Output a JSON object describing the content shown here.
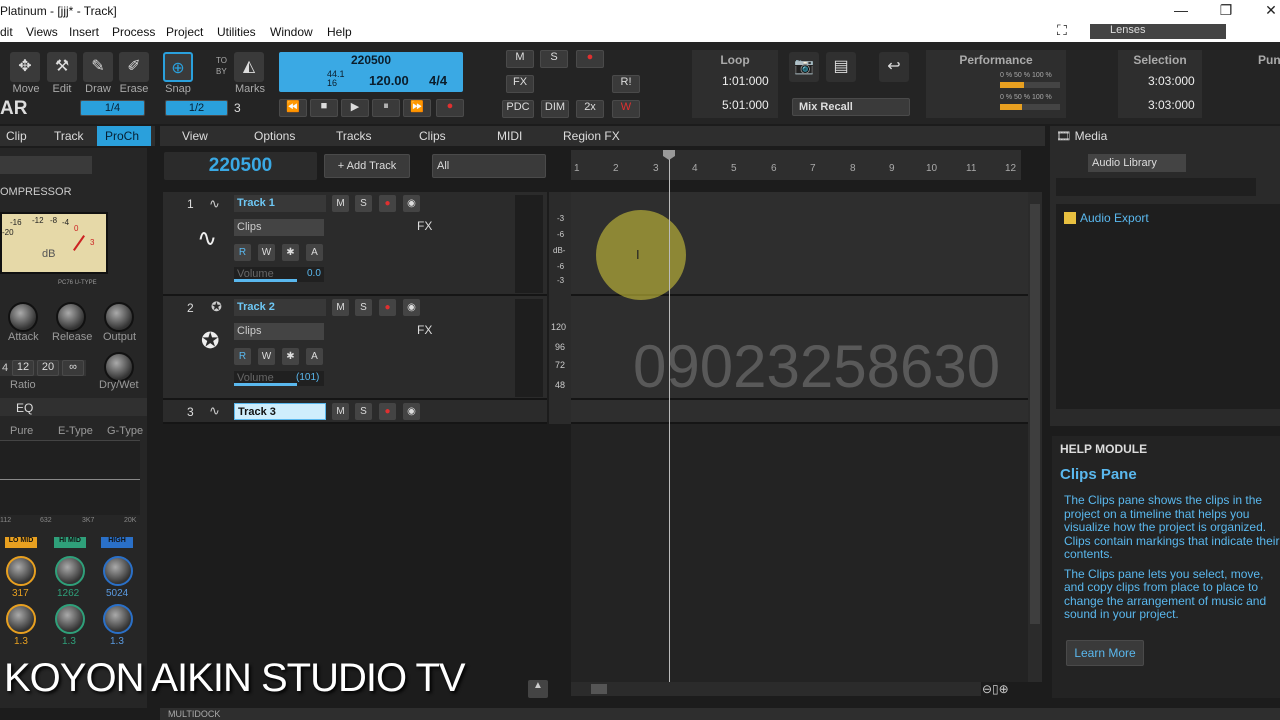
{
  "window": {
    "title": "Platinum - [jjj* - Track]",
    "minimize": "—",
    "maximize": "❐",
    "close": "✕"
  },
  "menu": [
    "dit",
    "Views",
    "Insert",
    "Process",
    "Project",
    "Utilities",
    "Window",
    "Help"
  ],
  "tools": {
    "items": [
      "Move",
      "Edit",
      "Draw",
      "Erase"
    ],
    "snap": "Snap",
    "marks": "Marks",
    "snap_value": "1/4",
    "grid_value": "1/2",
    "grid_count": "3",
    "to": "TO",
    "by": "BY",
    "logo": "AR"
  },
  "transport": {
    "position": "220500",
    "sample_rate": "44.1",
    "bit_depth": "16",
    "tempo": "120.00",
    "meter": "4/4"
  },
  "mix": {
    "m": "M",
    "s": "S",
    "fx": "FX",
    "pdc": "PDC",
    "dim": "DIM",
    "x2": "2x",
    "r": "R!",
    "w": "W"
  },
  "loop": {
    "title": "Loop",
    "start": "1:01:000",
    "end": "5:01:000",
    "mix_recall": "Mix Recall"
  },
  "performance": {
    "title": "Performance",
    "cpu1": "0 %",
    "cpu1b": "50 %",
    "cpu1c": "100 %",
    "cpu2": "0 %",
    "cpu2b": "50 %",
    "cpu2c": "100 %"
  },
  "selection": {
    "title": "Selection",
    "start": "3:03:000",
    "end": "3:03:000",
    "punch": "Pun"
  },
  "inspector": {
    "tabs": [
      "Clip",
      "Track",
      "ProCh"
    ],
    "compressor": "OMPRESSOR",
    "db": "dB",
    "scale": [
      "-16",
      "-12",
      "-8",
      "-4",
      "-20",
      "0",
      "3"
    ],
    "model": "PC76 U-TYPE",
    "knobs": [
      "Attack",
      "Release",
      "Output"
    ],
    "ratios": [
      "4",
      "12",
      "20",
      "∞"
    ],
    "ratio": "Ratio",
    "drywet": "Dry/Wet",
    "eq": "EQ",
    "eq_types": [
      "Pure",
      "E-Type",
      "G-Type"
    ],
    "eq_freqs": [
      "112",
      "632",
      "3K7",
      "20K"
    ],
    "bands": [
      {
        "name": "LO MID",
        "freq": "317",
        "q": "1.3"
      },
      {
        "name": "HI MID",
        "freq": "1262",
        "q": "1.3"
      },
      {
        "name": "HIGH",
        "freq": "5024",
        "q": "1.3"
      }
    ]
  },
  "trackview": {
    "menus": [
      "View",
      "Options",
      "Tracks",
      "Clips",
      "MIDI",
      "Region FX"
    ],
    "position": "220500",
    "add_track": "Add Track",
    "filter": "All",
    "ruler": [
      "1",
      "2",
      "3",
      "4",
      "5",
      "6",
      "7",
      "8",
      "9",
      "10",
      "11",
      "12"
    ],
    "tracks": [
      {
        "num": "1",
        "name": "Track 1",
        "clips": "Clips",
        "fx": "FX",
        "param": "Volume",
        "value": "0.0",
        "fill": 0.72
      },
      {
        "num": "2",
        "name": "Track 2",
        "clips": "Clips",
        "fx": "FX",
        "param": "Volume",
        "value": "(101)",
        "fill": 0.72
      },
      {
        "num": "3",
        "name": "Track 3"
      }
    ],
    "btn": {
      "m": "M",
      "s": "S",
      "r": "R",
      "w": "W",
      "a": "A"
    },
    "meter1": [
      "-3",
      "-6",
      "dB-",
      "-6",
      "-3"
    ],
    "meter2": [
      "120",
      "96",
      "72",
      "48"
    ],
    "watermark": "09023258630"
  },
  "browser": {
    "tab": "Media",
    "library": "Audio Library",
    "folder": "Audio Export"
  },
  "help": {
    "title": "HELP MODULE",
    "heading": "Clips Pane",
    "p1": "The Clips pane shows the clips in the project on a timeline that helps you visualize how the project is organized. Clips contain markings that indicate their contents.",
    "p2": "The Clips pane lets you select, move, and copy clips from place to place to change the arrangement of music and sound in your project.",
    "learn_more": "Learn More"
  },
  "overlay": {
    "studio": "KOYON AIKIN STUDIO TV",
    "multidock": "MULTIDOCK"
  }
}
